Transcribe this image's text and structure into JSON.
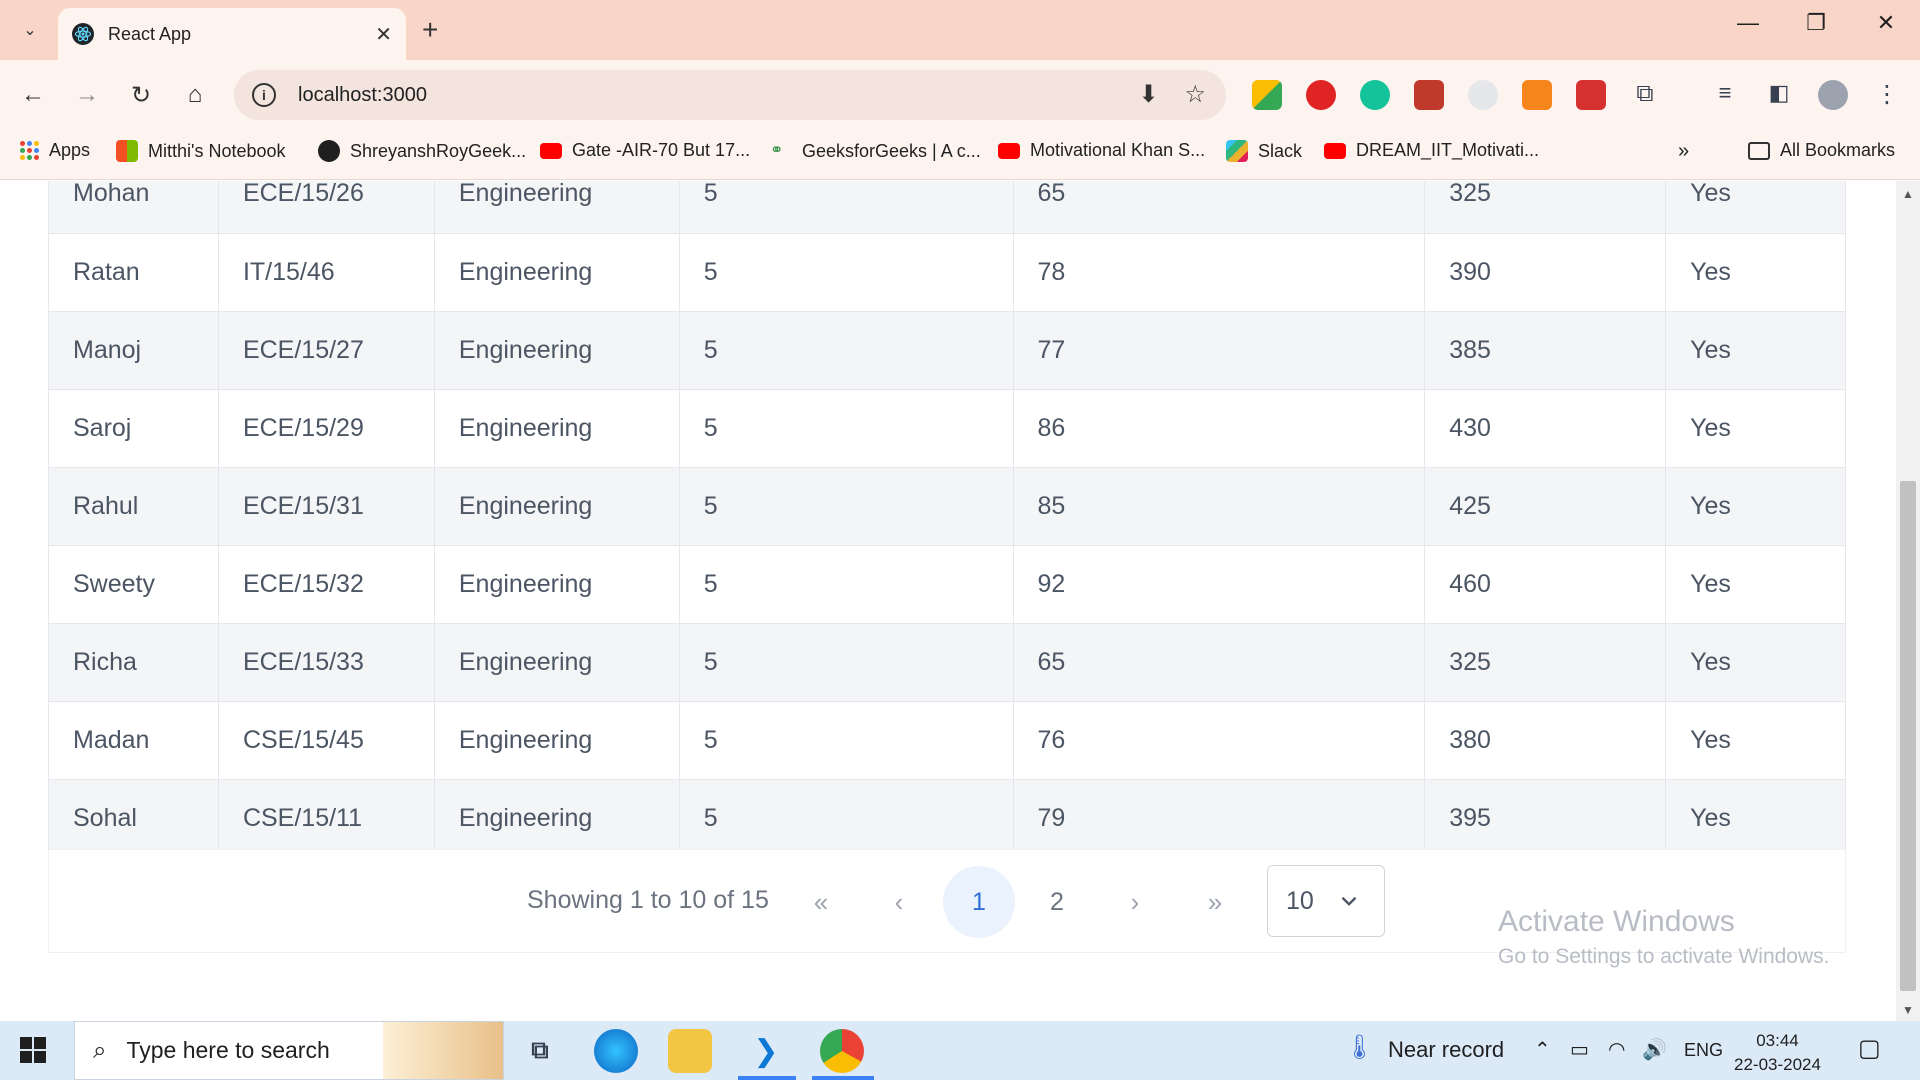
{
  "browser": {
    "tab_title": "React App",
    "url": "localhost:3000",
    "bookmarks": [
      {
        "label": "Apps",
        "icon": "apps-grid-icon",
        "color": "#4285f4"
      },
      {
        "label": "Mitthi's Notebook",
        "icon": "microsoft-icon",
        "color": "#f25022"
      },
      {
        "label": "ShreyanshRoyGeek...",
        "icon": "github-icon",
        "color": "#1f1f1f"
      },
      {
        "label": "Gate -AIR-70 But 17...",
        "icon": "youtube-icon",
        "color": "#ff0000"
      },
      {
        "label": "GeeksforGeeks | A c...",
        "icon": "gfg-icon",
        "color": "#2f8d46"
      },
      {
        "label": "Motivational Khan S...",
        "icon": "youtube-icon",
        "color": "#ff0000"
      },
      {
        "label": "Slack",
        "icon": "slack-icon",
        "color": "#e01e5a"
      },
      {
        "label": "DREAM_IIT_Motivati...",
        "icon": "youtube-icon",
        "color": "#ff0000"
      }
    ],
    "all_bookmarks": "All Bookmarks"
  },
  "table": {
    "rows": [
      {
        "name": "Mohan",
        "roll": "ECE/15/26",
        "dept": "Engineering",
        "credits": "5",
        "marks": "65",
        "total": "325",
        "pass": "Yes"
      },
      {
        "name": "Ratan",
        "roll": "IT/15/46",
        "dept": "Engineering",
        "credits": "5",
        "marks": "78",
        "total": "390",
        "pass": "Yes"
      },
      {
        "name": "Manoj",
        "roll": "ECE/15/27",
        "dept": "Engineering",
        "credits": "5",
        "marks": "77",
        "total": "385",
        "pass": "Yes"
      },
      {
        "name": "Saroj",
        "roll": "ECE/15/29",
        "dept": "Engineering",
        "credits": "5",
        "marks": "86",
        "total": "430",
        "pass": "Yes"
      },
      {
        "name": "Rahul",
        "roll": "ECE/15/31",
        "dept": "Engineering",
        "credits": "5",
        "marks": "85",
        "total": "425",
        "pass": "Yes"
      },
      {
        "name": "Sweety",
        "roll": "ECE/15/32",
        "dept": "Engineering",
        "credits": "5",
        "marks": "92",
        "total": "460",
        "pass": "Yes"
      },
      {
        "name": "Richa",
        "roll": "ECE/15/33",
        "dept": "Engineering",
        "credits": "5",
        "marks": "65",
        "total": "325",
        "pass": "Yes"
      },
      {
        "name": "Madan",
        "roll": "CSE/15/45",
        "dept": "Engineering",
        "credits": "5",
        "marks": "76",
        "total": "380",
        "pass": "Yes"
      },
      {
        "name": "Sohal",
        "roll": "CSE/15/11",
        "dept": "Engineering",
        "credits": "5",
        "marks": "79",
        "total": "395",
        "pass": "Yes"
      }
    ]
  },
  "pagination": {
    "showing": "Showing 1 to 10 of 15",
    "first": "«",
    "prev": "‹",
    "pages": [
      "1",
      "2"
    ],
    "active_page": "1",
    "next": "›",
    "last": "»",
    "page_size": "10"
  },
  "watermark": {
    "line1": "Activate Windows",
    "line2": "Go to Settings to activate Windows."
  },
  "taskbar": {
    "search_placeholder": "Type here to search",
    "weather": "Near record",
    "language": "ENG",
    "time": "03:44",
    "date": "22-03-2024"
  },
  "colors": {
    "tabbar": "#f9d5c8",
    "accent": "#2f6fd6",
    "active_page_bg": "#eaf2fd",
    "row_alt": "#f4f5f7"
  }
}
